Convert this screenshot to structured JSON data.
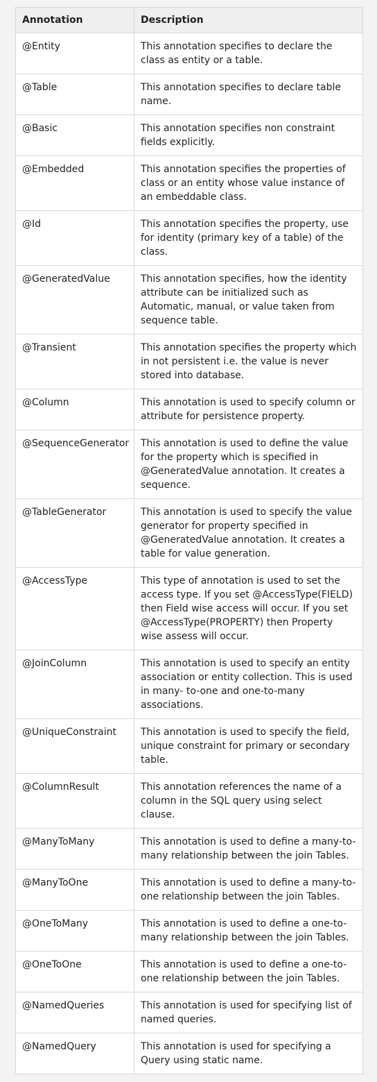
{
  "table": {
    "headers": [
      "Annotation",
      "Description"
    ],
    "rows": [
      {
        "annotation": "@Entity",
        "description": "This annotation specifies to declare the class as entity or a table."
      },
      {
        "annotation": "@Table",
        "description": "This annotation specifies to declare table name."
      },
      {
        "annotation": "@Basic",
        "description": "This annotation specifies non constraint fields explicitly."
      },
      {
        "annotation": "@Embedded",
        "description": "This annotation specifies the properties of class or an entity whose value instance of an embeddable class."
      },
      {
        "annotation": "@Id",
        "description": "This annotation specifies the property, use for identity (primary key of a table) of the class."
      },
      {
        "annotation": "@GeneratedValue",
        "description": "This annotation specifies, how the identity attribute can be initialized such as Automatic, manual, or value taken from sequence table."
      },
      {
        "annotation": "@Transient",
        "description": "This annotation specifies the property which in not persistent i.e. the value is never stored into database."
      },
      {
        "annotation": "@Column",
        "description": "This annotation is used to specify column or attribute for persistence property."
      },
      {
        "annotation": "@SequenceGenerator",
        "description": "This annotation is used to define the value for the property which is specified in @GeneratedValue annotation. It creates a sequence."
      },
      {
        "annotation": "@TableGenerator",
        "description": "This annotation is used to specify the value generator for property specified in @GeneratedValue annotation. It creates a table for value generation."
      },
      {
        "annotation": "@AccessType",
        "description": "This type of annotation is used to set the access type. If you set @AccessType(FIELD) then Field wise access will occur. If you set @AccessType(PROPERTY) then Property wise assess will occur."
      },
      {
        "annotation": "@JoinColumn",
        "description": "This annotation is used to specify an entity association or entity collection. This is used in many- to-one and one-to-many associations."
      },
      {
        "annotation": "@UniqueConstraint",
        "description": "This annotation is used to specify the field, unique constraint for primary or secondary table."
      },
      {
        "annotation": "@ColumnResult",
        "description": "This annotation references the name of a column in the SQL query using select clause."
      },
      {
        "annotation": "@ManyToMany",
        "description": "This annotation is used to define a many-to-many relationship between the join Tables."
      },
      {
        "annotation": "@ManyToOne",
        "description": "This annotation is used to define a many-to-one relationship between the join Tables."
      },
      {
        "annotation": "@OneToMany",
        "description": "This annotation is used to define a one-to-many relationship between the join Tables."
      },
      {
        "annotation": "@OneToOne",
        "description": "This annotation is used to define a one-to-one relationship between the join Tables."
      },
      {
        "annotation": "@NamedQueries",
        "description": "This annotation is used for specifying list of named queries."
      },
      {
        "annotation": "@NamedQuery",
        "description": "This annotation is used for specifying a Query using static name."
      }
    ]
  }
}
